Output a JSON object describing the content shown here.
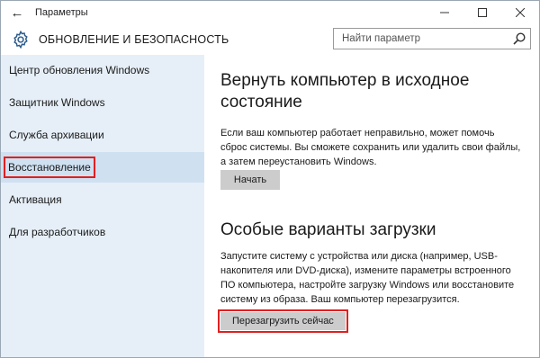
{
  "titlebar": {
    "back_icon": "←",
    "title": "Параметры",
    "minimize_icon": "—",
    "maximize_icon": "☐",
    "close_icon": "✕"
  },
  "header": {
    "gear_icon": "gear-icon",
    "section_title": "ОБНОВЛЕНИЕ И БЕЗОПАСНОСТЬ",
    "search_placeholder": "Найти параметр",
    "search_value": ""
  },
  "sidebar": {
    "items": [
      {
        "label": "Центр обновления Windows"
      },
      {
        "label": "Защитник Windows"
      },
      {
        "label": "Служба архивации"
      },
      {
        "label": "Восстановление",
        "selected": true
      },
      {
        "label": "Активация"
      },
      {
        "label": "Для разработчиков"
      }
    ]
  },
  "main": {
    "reset": {
      "heading_line1": "Вернуть компьютер в исходное",
      "heading_line2": "состояние",
      "desc_line1": "Если ваш компьютер работает неправильно, может помочь",
      "desc_line2": "сброс системы. Вы сможете сохранить или удалить свои файлы,",
      "desc_line3": "а затем переустановить Windows.",
      "button": "Начать"
    },
    "advanced": {
      "heading": "Особые варианты загрузки",
      "desc_line1": "Запустите систему с устройства или диска (например, USB-",
      "desc_line2": "накопителя или DVD-диска), измените параметры встроенного",
      "desc_line3": "ПО компьютера, настройте загрузку Windows или восстановите",
      "desc_line4": "систему из образа. Ваш компьютер перезагрузится.",
      "button": "Перезагрузить сейчас"
    }
  },
  "colors": {
    "sidebar_bg": "#e6eff8",
    "selected_bg": "#cfe0f1",
    "highlight_red": "#e0201f",
    "button_bg": "#cccccc"
  }
}
